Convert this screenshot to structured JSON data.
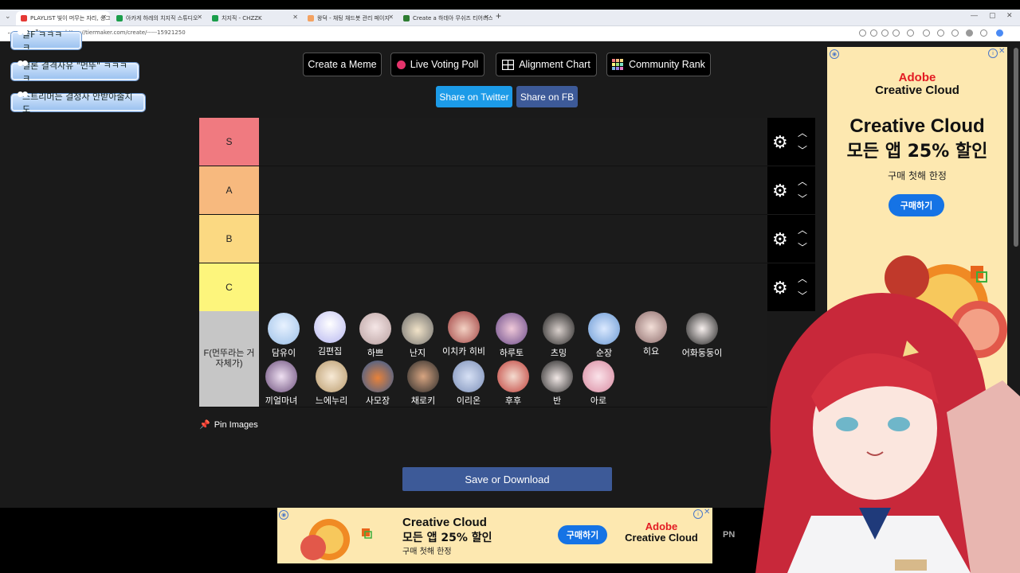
{
  "browser": {
    "tabs": [
      {
        "label": "PLAYLIST 빛이 머무는 자리, 싱그",
        "color": "#e53935"
      },
      {
        "label": "아카게 하레의 치지직 스튜디오",
        "color": "#1b9e4b"
      },
      {
        "label": "치지직 - CHZZK",
        "color": "#1b9e4b"
      },
      {
        "label": "왕덕 - 채팅 채드봇 관리 페이지",
        "color": "#f4a261"
      },
      {
        "label": "Create a 하데아 무쉬즈 티어리스트",
        "color": "#2e7d32"
      }
    ],
    "new_tab": "+",
    "url": "https://tiermaker.com/create/-----15921250"
  },
  "chat_bubbles": [
    "을F ㅋㅋㅋㅋ",
    "결론 결격사유 \"먼뚜\" ㅋㅋㅋㅋ",
    "스트리머는 결정사 안받아줄지도"
  ],
  "toolbar": {
    "create_meme": "Create a Meme",
    "live_voting": "Live Voting Poll",
    "alignment_chart": "Alignment Chart",
    "community_rank": "Community Rank",
    "share_twitter": "Share on Twitter",
    "share_fb": "Share on FB"
  },
  "tiers": [
    {
      "label": "S",
      "color": "#f07a80"
    },
    {
      "label": "A",
      "color": "#f7b97e"
    },
    {
      "label": "B",
      "color": "#fbd982"
    },
    {
      "label": "C",
      "color": "#fdf57c"
    },
    {
      "label": "F(먼뚜라는 거 자체가)",
      "color": "#c6c6c6"
    }
  ],
  "f_items_row1": [
    "담유이",
    "김편집",
    "하쁘",
    "난지",
    "이치카 히비",
    "하루토",
    "츠밍",
    "순장",
    "히요",
    "어화둥둥이"
  ],
  "f_items_row2": [
    "끼얼마녀",
    "느에누리",
    "사모장",
    "채로키",
    "이리온",
    "후후",
    "반",
    "아로"
  ],
  "pin_images": "Pin Images",
  "save_download": "Save or Download",
  "ad_right": {
    "brand1": "Adobe",
    "brand2": "Creative Cloud",
    "headline1": "Creative Cloud",
    "headline2": "모든 앱 25% 할인",
    "sub": "구매 첫해 한정",
    "cta": "구매하기"
  },
  "ad_bottom": {
    "line1": "Creative Cloud",
    "line2": "모든 앱 25% 할인",
    "line3": "구매 첫해 한정",
    "cta": "구매하기",
    "brand1": "Adobe",
    "brand2": "Creative Cloud"
  },
  "partial_text": "PN"
}
